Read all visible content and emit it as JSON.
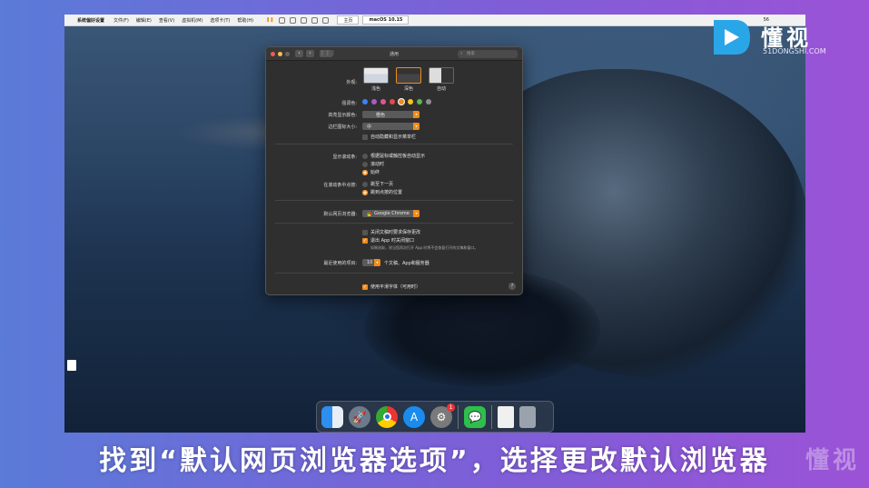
{
  "vm_toolbar": {
    "app_name": "系统偏好设置",
    "menu": [
      "文件(F)",
      "编辑(E)",
      "查看(V)",
      "虚拟机(M)",
      "选项卡(T)",
      "帮助(H)"
    ],
    "tabs": [
      "主页",
      "macOS 10.15"
    ],
    "right_number": "56"
  },
  "logo": {
    "text": "懂视",
    "sub": "51DONGSHI.COM"
  },
  "window": {
    "title": "通用",
    "search_placeholder": "搜索",
    "appearance_label": "外观:",
    "appearance_options": [
      "浅色",
      "深色",
      "自动"
    ],
    "accent_label": "强调色:",
    "accent_colors": [
      "#3b82f6",
      "#a35cc9",
      "#e4558f",
      "#e24b47",
      "#f08c1c",
      "#f5c51c",
      "#5bb84a",
      "#8e8e93"
    ],
    "highlight_label": "高亮显示颜色:",
    "highlight_value": "橙色",
    "sidebar_label": "边栏图标大小:",
    "sidebar_value": "中",
    "auto_hide_menu": "自动隐藏和显示菜单栏",
    "scrollbars_label": "显示滚动条:",
    "scrollbar_options": [
      "根据鼠标或触控板自动显示",
      "滚动时",
      "始终"
    ],
    "click_label": "在滚动条中点按:",
    "click_options": [
      "跳至下一页",
      "跳到点按的位置"
    ],
    "browser_label": "默认网页浏览器:",
    "browser_value": "Google Chrome",
    "ask_keep": "关闭文稿时要求保存更改",
    "close_windows": "退出 App 时关闭窗口",
    "close_windows_note": "如果选取，则当您再次打开 App 时将不会恢复打开的文稿和窗口。",
    "recent_label": "最近使用的项目:",
    "recent_value": "10",
    "recent_suffix": "个文稿、App和服务器",
    "smoothing": "使用平滑字体（可用时）",
    "help": "?"
  },
  "dock": {
    "items": [
      "finder-icon",
      "launchpad-icon",
      "chrome-icon",
      "app-store-icon",
      "system-preferences-icon",
      "wechat-icon",
      "document-icon",
      "trash-icon"
    ],
    "badge": "1"
  },
  "subtitle": "找到“默认网页浏览器选项”，选择更改默认浏览器",
  "watermark": "懂视"
}
